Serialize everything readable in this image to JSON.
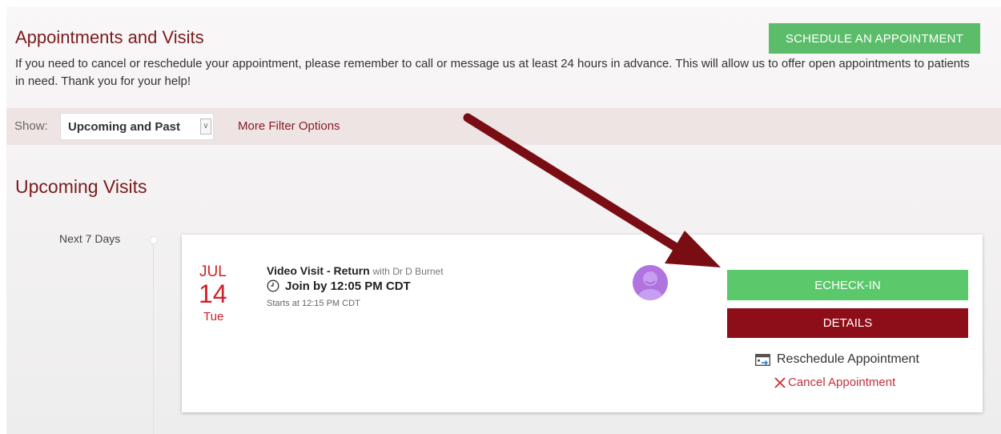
{
  "header": {
    "title": "Appointments and Visits",
    "schedule_button": "SCHEDULE AN APPOINTMENT",
    "notice": "If you need to cancel or reschedule your appointment, please remember to call or message us at least 24 hours in advance. This will allow us to offer open appointments to patients in need. Thank you for your help!"
  },
  "filters": {
    "show_label": "Show:",
    "selected": "Upcoming and Past",
    "more_filters": "More Filter Options"
  },
  "upcoming": {
    "section_title": "Upcoming Visits",
    "range_label": "Next 7 Days",
    "appointment": {
      "month": "JUL",
      "day": "14",
      "weekday": "Tue",
      "visit_type": "Video Visit - Return",
      "provider": "with Dr D Burnet",
      "join_text": "Join by 12:05 PM CDT",
      "starts_text": "Starts at 12:15 PM CDT",
      "echeckin_label": "ECHECK-IN",
      "details_label": "DETAILS",
      "reschedule_label": "Reschedule Appointment",
      "cancel_label": "Cancel Appointment"
    }
  },
  "colors": {
    "brand": "#7a1b1f",
    "primary_green": "#5bbd6a",
    "details_red": "#8d0e18",
    "date_red": "#d0202a",
    "arrow": "#7a0c14"
  },
  "icons": {
    "clock": "clock-icon",
    "avatar": "avatar",
    "reschedule": "calendar-arrow-icon",
    "cancel": "close-icon",
    "dropdown": "chevron-down-icon"
  }
}
